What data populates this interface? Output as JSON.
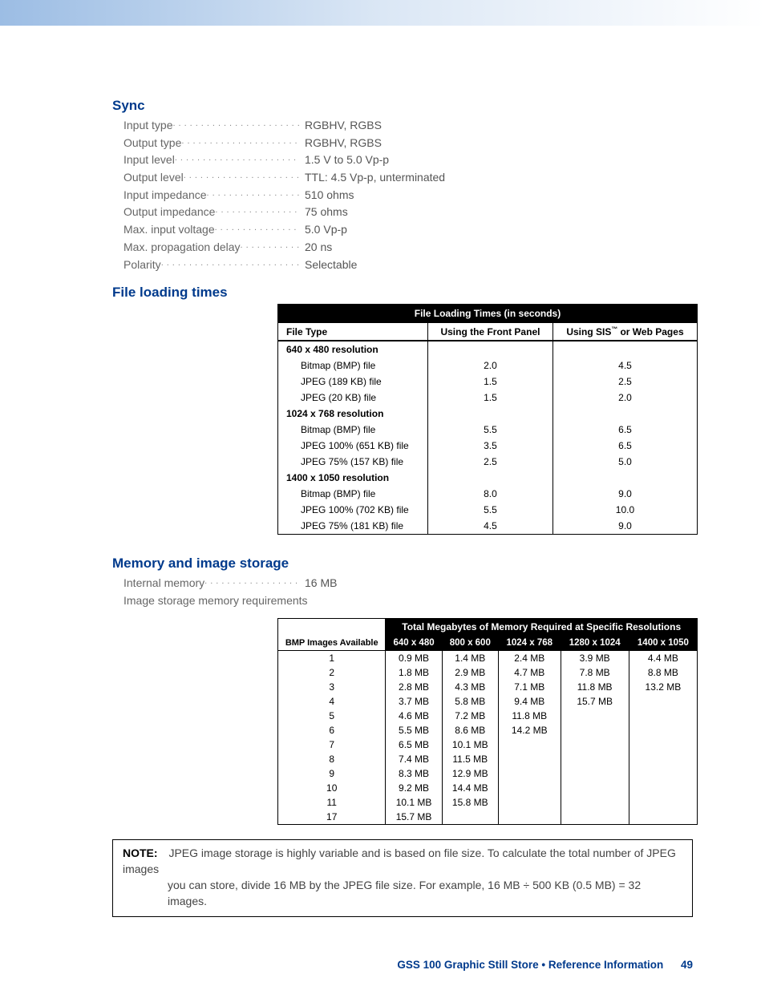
{
  "sync": {
    "title": "Sync",
    "rows": [
      {
        "label": "Input type",
        "value": "RGBHV, RGBS"
      },
      {
        "label": "Output type",
        "value": "RGBHV, RGBS"
      },
      {
        "label": "Input level",
        "value": "1.5 V to 5.0 Vp-p"
      },
      {
        "label": "Output level",
        "value": "TTL: 4.5 Vp-p, unterminated"
      },
      {
        "label": "Input impedance",
        "value": "510 ohms"
      },
      {
        "label": "Output impedance",
        "value": "75 ohms"
      },
      {
        "label": "Max. input voltage",
        "value": "5.0 Vp-p"
      },
      {
        "label": "Max. propagation delay",
        "value": "20 ns"
      },
      {
        "label": "Polarity",
        "value": "Selectable"
      }
    ]
  },
  "flt": {
    "title": "File loading times",
    "table_title": "File Loading Times (in seconds)",
    "col1": "File Type",
    "col2": "Using the Front Panel",
    "col3_pre": "Using SIS",
    "col3_post": " or Web Pages",
    "groups": [
      {
        "name": "640 x 480 resolution",
        "rows": [
          {
            "name": "Bitmap (BMP) file",
            "a": "2.0",
            "b": "4.5"
          },
          {
            "name": "JPEG (189 KB) file",
            "a": "1.5",
            "b": "2.5"
          },
          {
            "name": "JPEG (20 KB) file",
            "a": "1.5",
            "b": "2.0"
          }
        ]
      },
      {
        "name": "1024 x 768 resolution",
        "rows": [
          {
            "name": "Bitmap (BMP) file",
            "a": "5.5",
            "b": "6.5"
          },
          {
            "name": "JPEG 100% (651 KB) file",
            "a": "3.5",
            "b": "6.5"
          },
          {
            "name": "JPEG 75% (157 KB) file",
            "a": "2.5",
            "b": "5.0"
          }
        ]
      },
      {
        "name": "1400 x 1050 resolution",
        "rows": [
          {
            "name": "Bitmap (BMP) file",
            "a": "8.0",
            "b": "9.0"
          },
          {
            "name": "JPEG 100% (702 KB) file",
            "a": "5.5",
            "b": "10.0"
          },
          {
            "name": "JPEG 75% (181 KB) file",
            "a": "4.5",
            "b": "9.0"
          }
        ]
      }
    ]
  },
  "mem": {
    "title": "Memory and image storage",
    "spec1_label": "Internal memory",
    "spec1_value": "16 MB",
    "spec2_label": "Image storage memory requirements",
    "table_title": "Total Megabytes of Memory Required at Specific Resolutions",
    "corner": "BMP Images Available",
    "cols": [
      "640 x 480",
      "800 x 600",
      "1024 x 768",
      "1280 x 1024",
      "1400 x 1050"
    ],
    "rows": [
      {
        "n": "1",
        "c": [
          "0.9 MB",
          "1.4 MB",
          "2.4 MB",
          "3.9 MB",
          "4.4 MB"
        ]
      },
      {
        "n": "2",
        "c": [
          "1.8 MB",
          "2.9 MB",
          "4.7 MB",
          "7.8 MB",
          "8.8 MB"
        ]
      },
      {
        "n": "3",
        "c": [
          "2.8 MB",
          "4.3 MB",
          "7.1 MB",
          "11.8 MB",
          "13.2 MB"
        ]
      },
      {
        "n": "4",
        "c": [
          "3.7 MB",
          "5.8 MB",
          "9.4 MB",
          "15.7 MB",
          ""
        ]
      },
      {
        "n": "5",
        "c": [
          "4.6 MB",
          "7.2 MB",
          "11.8 MB",
          "",
          ""
        ]
      },
      {
        "n": "6",
        "c": [
          "5.5 MB",
          "8.6 MB",
          "14.2 MB",
          "",
          ""
        ]
      },
      {
        "n": "7",
        "c": [
          "6.5 MB",
          "10.1 MB",
          "",
          "",
          ""
        ]
      },
      {
        "n": "8",
        "c": [
          "7.4 MB",
          "11.5 MB",
          "",
          "",
          ""
        ]
      },
      {
        "n": "9",
        "c": [
          "8.3 MB",
          "12.9 MB",
          "",
          "",
          ""
        ]
      },
      {
        "n": "10",
        "c": [
          "9.2 MB",
          "14.4 MB",
          "",
          "",
          ""
        ]
      },
      {
        "n": "11",
        "c": [
          "10.1 MB",
          "15.8 MB",
          "",
          "",
          ""
        ]
      },
      {
        "n": "17",
        "c": [
          "15.7 MB",
          "",
          "",
          "",
          ""
        ]
      }
    ]
  },
  "note": {
    "label": "NOTE:",
    "line1": "JPEG image storage is highly variable and is based on file size. To calculate the total number of JPEG images",
    "line2": "you can store, divide 16 MB by the JPEG file size. For example, 16 MB ÷ 500 KB (0.5 MB) = 32 images."
  },
  "footer": {
    "text": "GSS 100 Graphic Still Store • Reference Information",
    "page": "49"
  },
  "chart_data": [
    {
      "type": "table",
      "title": "File Loading Times (in seconds)",
      "columns": [
        "File Type",
        "Using the Front Panel",
        "Using SIS or Web Pages"
      ],
      "rows": [
        [
          "640 x 480 — Bitmap (BMP) file",
          2.0,
          4.5
        ],
        [
          "640 x 480 — JPEG (189 KB) file",
          1.5,
          2.5
        ],
        [
          "640 x 480 — JPEG (20 KB) file",
          1.5,
          2.0
        ],
        [
          "1024 x 768 — Bitmap (BMP) file",
          5.5,
          6.5
        ],
        [
          "1024 x 768 — JPEG 100% (651 KB) file",
          3.5,
          6.5
        ],
        [
          "1024 x 768 — JPEG 75% (157 KB) file",
          2.5,
          5.0
        ],
        [
          "1400 x 1050 — Bitmap (BMP) file",
          8.0,
          9.0
        ],
        [
          "1400 x 1050 — JPEG 100% (702 KB) file",
          5.5,
          10.0
        ],
        [
          "1400 x 1050 — JPEG 75% (181 KB) file",
          4.5,
          9.0
        ]
      ]
    },
    {
      "type": "table",
      "title": "Total Megabytes of Memory Required at Specific Resolutions",
      "columns": [
        "BMP Images Available",
        "640 x 480",
        "800 x 600",
        "1024 x 768",
        "1280 x 1024",
        "1400 x 1050"
      ],
      "rows": [
        [
          1,
          0.9,
          1.4,
          2.4,
          3.9,
          4.4
        ],
        [
          2,
          1.8,
          2.9,
          4.7,
          7.8,
          8.8
        ],
        [
          3,
          2.8,
          4.3,
          7.1,
          11.8,
          13.2
        ],
        [
          4,
          3.7,
          5.8,
          9.4,
          15.7,
          null
        ],
        [
          5,
          4.6,
          7.2,
          11.8,
          null,
          null
        ],
        [
          6,
          5.5,
          8.6,
          14.2,
          null,
          null
        ],
        [
          7,
          6.5,
          10.1,
          null,
          null,
          null
        ],
        [
          8,
          7.4,
          11.5,
          null,
          null,
          null
        ],
        [
          9,
          8.3,
          12.9,
          null,
          null,
          null
        ],
        [
          10,
          9.2,
          14.4,
          null,
          null,
          null
        ],
        [
          11,
          10.1,
          15.8,
          null,
          null,
          null
        ],
        [
          17,
          15.7,
          null,
          null,
          null,
          null
        ]
      ],
      "units": "MB"
    }
  ]
}
